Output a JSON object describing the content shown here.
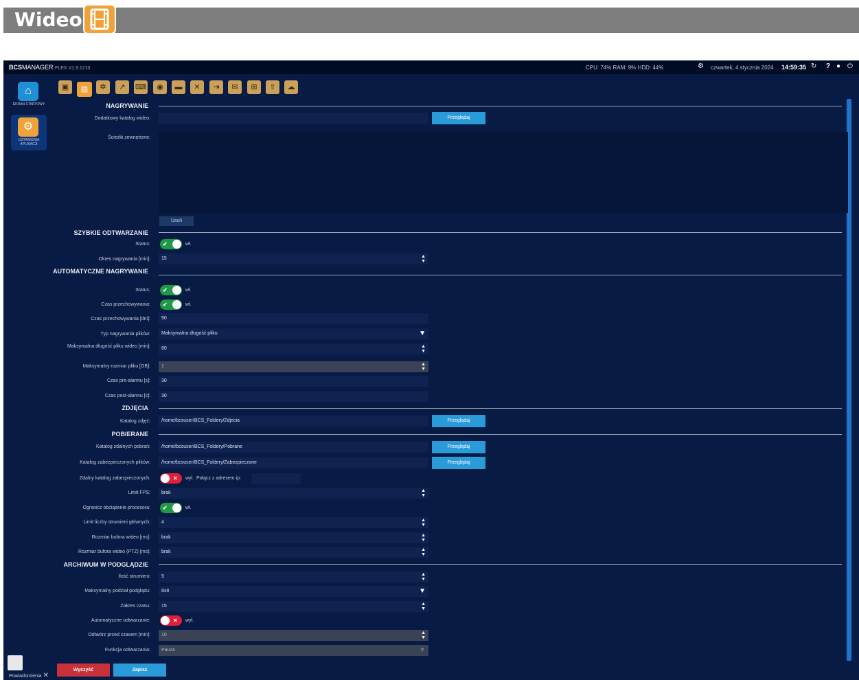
{
  "header": {
    "title": "Wideo",
    "icon": "film-icon",
    "bar_color": "#7d7d7d",
    "icon_color": "#f0a23a"
  },
  "topbar": {
    "brand": "BCS",
    "brand_suffix": "MANAGER",
    "version": "FLEX V1.9.1210",
    "stats": "CPU:  74%   RAM:   9%   HDD:  44%",
    "date": "czwartek, 4 stycznia 2024",
    "time": "14:59:35",
    "help": "?"
  },
  "sidebar": {
    "items": [
      {
        "label": "EKRAN STARTOWY",
        "icon": "home-icon"
      },
      {
        "label": "USTAWIENIA APLIKACJI",
        "icon": "gears-icon"
      }
    ],
    "notifications_label": "Powiadomienia"
  },
  "toolbar": {
    "icons": [
      "window-icon",
      "film-icon",
      "camera-settings-icon",
      "chart-icon",
      "keyboard-icon",
      "camera-icon",
      "car-icon",
      "tools-icon",
      "import-icon",
      "mail-icon",
      "network-icon",
      "upload-icon",
      "cloud-icon"
    ],
    "active_index": 1
  },
  "sections": {
    "nagrywanie": "NAGRYWANIE",
    "szybkie": "SZYBKIE ODTWARZANIE",
    "automatyczne": "AUTOMATYCZNE NAGRYWANIE",
    "zdjecia": "ZDJĘCIA",
    "pobierane": "POBIERANE",
    "archiwum": "ARCHIWUM W PODGLĄDZIE"
  },
  "nagrywanie": {
    "dodatkowy_label": "Dodatkowy katalog wideo:",
    "dodatkowy_value": "",
    "browse": "Przeglądaj",
    "sciezki_label": "Ścieżki zewnętrzne:",
    "usun": "Usuń"
  },
  "szybkie": {
    "status_label": "Status:",
    "status_text": "wł.",
    "okres_label": "Okres nagrywania [min]:",
    "okres_value": "15"
  },
  "automatyczne": {
    "status_label": "Status:",
    "status_text": "wł.",
    "czas_label": "Czas przechowywania:",
    "czas_text": "wł.",
    "czas_dni_label": "Czas przechowywania [dni]:",
    "czas_dni_value": "90",
    "typ_label": "Typ nagrywania plików:",
    "typ_value": "Maksymalna długość pliku",
    "maxdl_label": "Maksymalna długość pliku wideo [min]:",
    "maxdl_value": "60",
    "maxroz_label": "Maksymalny rozmiar pliku [GB]:",
    "maxroz_value": "1",
    "pre_label": "Czas pre-alarmu [s]:",
    "pre_value": "30",
    "post_label": "Czas post-alarmu [s]:",
    "post_value": "30"
  },
  "zdjecia": {
    "katalog_label": "Katalog zdjęć:",
    "katalog_value": "/home/bcsuser/BCS_Foldery/Zdjecia",
    "browse": "Przeglądaj"
  },
  "pobierane": {
    "zdalnych_label": "Katalog zdalnych pobrań:",
    "zdalnych_value": "/home/bcsuser/BCS_Foldery/Pobrane",
    "zabez_label": "Katalog zabezpieczonych plików:",
    "zabez_value": "/home/bcsuser/BCS_Foldery/Zabezpieczone",
    "browse": "Przeglądaj",
    "zdalny_label": "Zdalny katalog zabezpieczonych:",
    "zdalny_text": "wył.",
    "polacz_label": "Połącz z adresem ip:",
    "polacz_value": "",
    "fps_label": "Limit FPS:",
    "fps_value": "brak",
    "ogranicz_label": "Ogranicz obciążenie procesora:",
    "ogranicz_text": "wł.",
    "strumieni_label": "Limit liczby strumieni głównych:",
    "strumieni_value": "4",
    "bufor_label": "Rozmiar bufora wideo [ms]:",
    "bufor_value": "brak",
    "bufor_ptz_label": "Rozmiar bufora wideo (PTZ) [ms]:",
    "bufor_ptz_value": "brak"
  },
  "archiwum": {
    "ilosc_label": "Ilość strumieni:",
    "ilosc_value": "9",
    "podzial_label": "Maksymalny podział podglądu:",
    "podzial_value": "8x8",
    "zakres_label": "Zakres czasu:",
    "zakres_value": "15",
    "auto_label": "Automatyczne odtwarzanie:",
    "auto_text": "wył.",
    "odtworz_label": "Odtwórz przed czasem [min]:",
    "odtworz_value": "10",
    "funkcja_label": "Funkcja odtwarzania:",
    "funkcja_value": "Pauza"
  },
  "buttons": {
    "clear": "Wyczyść",
    "save": "Zapisz"
  },
  "colors": {
    "background": "#081b44",
    "accent": "#2a9ad8",
    "toggle_on": "#1f9b47",
    "toggle_off": "#e21e3c",
    "danger_button": "#c8303a"
  }
}
